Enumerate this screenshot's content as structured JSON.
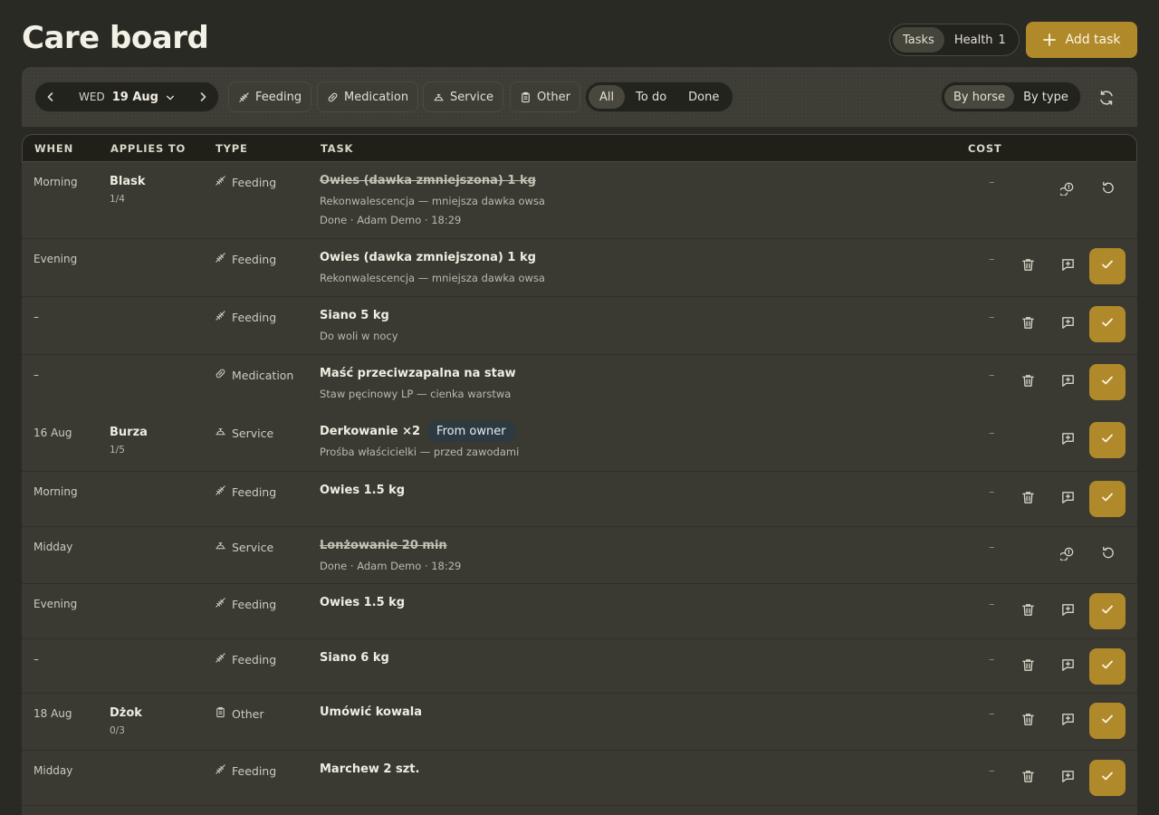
{
  "header": {
    "title": "Care board",
    "view_tabs": [
      {
        "label": "Tasks",
        "active": true,
        "count": ""
      },
      {
        "label": "Health",
        "active": false,
        "count": "1"
      }
    ],
    "add_button": "Add task"
  },
  "filters": {
    "date": {
      "dow": "WED",
      "day": "19 Aug"
    },
    "types": [
      "Feeding",
      "Medication",
      "Service",
      "Other"
    ],
    "status": [
      {
        "label": "All",
        "active": true
      },
      {
        "label": "To do",
        "active": false
      },
      {
        "label": "Done",
        "active": false
      }
    ],
    "grouping": [
      {
        "label": "By horse",
        "active": true
      },
      {
        "label": "By type",
        "active": false
      }
    ]
  },
  "table": {
    "columns": {
      "when": "WHEN",
      "applies_to": "APPLIES TO",
      "type": "TYPE",
      "task": "TASK",
      "cost": "COST"
    },
    "rows": [
      {
        "when": "Morning",
        "horse": "Blask",
        "horse_count": "1/4",
        "type": "Feeding",
        "type_icon": "feeding-icon",
        "title": "Owies (dawka zmniejszona) 1 kg",
        "done": true,
        "subs": [
          "Rekonwalescencja — mniejsza dawka owsa",
          "Done · Adam Demo · 18:29"
        ],
        "cost": "–",
        "badge": ""
      },
      {
        "when": "Evening",
        "horse": "",
        "horse_count": "",
        "type": "Feeding",
        "type_icon": "feeding-icon",
        "title": "Owies (dawka zmniejszona) 1 kg",
        "done": false,
        "subs": [
          "Rekonwalescencja — mniejsza dawka owsa"
        ],
        "cost": "–",
        "badge": ""
      },
      {
        "when": "–",
        "horse": "",
        "horse_count": "",
        "type": "Feeding",
        "type_icon": "feeding-icon",
        "title": "Siano 5 kg",
        "done": false,
        "subs": [
          "Do woli w nocy"
        ],
        "cost": "–",
        "badge": ""
      },
      {
        "when": "–",
        "horse": "",
        "horse_count": "",
        "type": "Medication",
        "type_icon": "medication-icon",
        "title": "Maść przeciwzapalna na staw",
        "done": false,
        "subs": [
          "Staw pęcinowy LP — cienka warstwa"
        ],
        "cost": "–",
        "badge": ""
      },
      {
        "when": "16 Aug",
        "horse": "Burza",
        "horse_count": "1/5",
        "type": "Service",
        "type_icon": "service-icon",
        "title": "Derkowanie ×2",
        "done": false,
        "subs": [
          "Prośba właścicielki — przed zawodami"
        ],
        "cost": "–",
        "badge": "From owner"
      },
      {
        "when": "Morning",
        "horse": "",
        "horse_count": "",
        "type": "Feeding",
        "type_icon": "feeding-icon",
        "title": "Owies 1.5 kg",
        "done": false,
        "subs": [],
        "cost": "–",
        "badge": ""
      },
      {
        "when": "Midday",
        "horse": "",
        "horse_count": "",
        "type": "Service",
        "type_icon": "service-icon",
        "title": "Lonżowanie 20 min",
        "done": true,
        "subs": [
          "Done · Adam Demo · 18:29"
        ],
        "cost": "–",
        "badge": ""
      },
      {
        "when": "Evening",
        "horse": "",
        "horse_count": "",
        "type": "Feeding",
        "type_icon": "feeding-icon",
        "title": "Owies 1.5 kg",
        "done": false,
        "subs": [],
        "cost": "–",
        "badge": ""
      },
      {
        "when": "–",
        "horse": "",
        "horse_count": "",
        "type": "Feeding",
        "type_icon": "feeding-icon",
        "title": "Siano 6 kg",
        "done": false,
        "subs": [],
        "cost": "–",
        "badge": ""
      },
      {
        "when": "18 Aug",
        "horse": "Dżok",
        "horse_count": "0/3",
        "type": "Other",
        "type_icon": "clipboard-icon",
        "title": "Umówić kowala",
        "done": false,
        "subs": [],
        "cost": "–",
        "badge": ""
      },
      {
        "when": "Midday",
        "horse": "",
        "horse_count": "",
        "type": "Feeding",
        "type_icon": "feeding-icon",
        "title": "Marchew 2 szt.",
        "done": false,
        "subs": [],
        "cost": "–",
        "badge": ""
      }
    ]
  },
  "colors": {
    "accent": "#b08a2a",
    "background": "#2a2a24",
    "panel": "#3a3932"
  }
}
